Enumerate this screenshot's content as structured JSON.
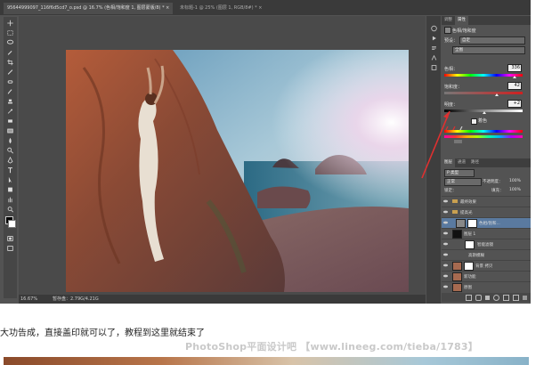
{
  "window": {
    "tab1": "95644999097_116f6d5cd7_o.psd @ 16.7% (色相/饱和度 1, 图层蒙版/8) * ×",
    "tab2": "未标题-1 @ 25% (图层 1, RGB/8#) * ×"
  },
  "status": {
    "zoom": "16.67%",
    "doc": "暂存盘：2.79G/4.21G"
  },
  "adjust_panel": {
    "tabs": [
      "调整",
      "属性"
    ],
    "title": "色相/饱和度",
    "preset_label": "预设：",
    "preset_value": "自定",
    "channel_value": "全图",
    "hue_label": "色相：",
    "hue_value": "336",
    "sat_label": "饱和度：",
    "sat_value": "42",
    "light_label": "明度：",
    "light_value": "+2",
    "colorize_label": "着色"
  },
  "layers_panel": {
    "tabs": [
      "图层",
      "通道",
      "路径"
    ],
    "kind_label": "P 类型",
    "blend_mode": "正常",
    "opacity_label": "不透明度：",
    "opacity_value": "100%",
    "lock_label": "锁定：",
    "fill_label": "填充：",
    "fill_value": "100%",
    "layers": [
      {
        "name": "最终效果"
      },
      {
        "name": "提高光"
      },
      {
        "name": "色相/饱和..."
      },
      {
        "name": "图层 1"
      },
      {
        "name": "智能滤镜"
      },
      {
        "name": "高斯模糊"
      },
      {
        "name": "背景 拷贝"
      },
      {
        "name": "新功能"
      },
      {
        "name": "原图"
      }
    ]
  },
  "page": {
    "caption": "大功告成，直接盖印就可以了，教程到这里就结束了",
    "watermark": "PhotoShop平面设计吧 【www.lineeg.com/tieba/1783】"
  },
  "colors": {
    "ps_bg": "#535353",
    "arrow": "#e03030",
    "accent": "#cc2222"
  }
}
